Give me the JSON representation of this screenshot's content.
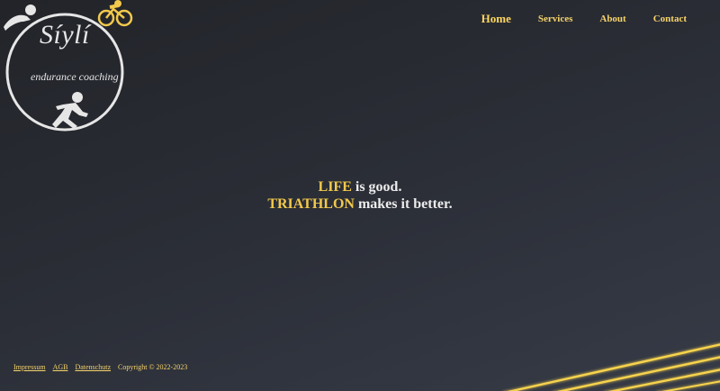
{
  "logo": {
    "title": "Síylí",
    "subtitle": "endurance coaching"
  },
  "nav": {
    "items": [
      {
        "label": "Home"
      },
      {
        "label": "Services"
      },
      {
        "label": "About"
      },
      {
        "label": "Contact"
      }
    ]
  },
  "hero": {
    "line1_accent": "LIFE",
    "line1_rest": " is good.",
    "line2_accent": "TRIATHLON",
    "line2_rest": " makes it better."
  },
  "footer": {
    "links": [
      {
        "label": "Impressum"
      },
      {
        "label": "AGB"
      },
      {
        "label": "Datenschutz"
      }
    ],
    "copyright": "Copyright © 2022-2023"
  },
  "colors": {
    "accent": "#f2c94c",
    "nav": "#f6d36a",
    "background_top": "#222429",
    "background_bottom": "#363b47",
    "logo_line": "#e6e6e6"
  }
}
